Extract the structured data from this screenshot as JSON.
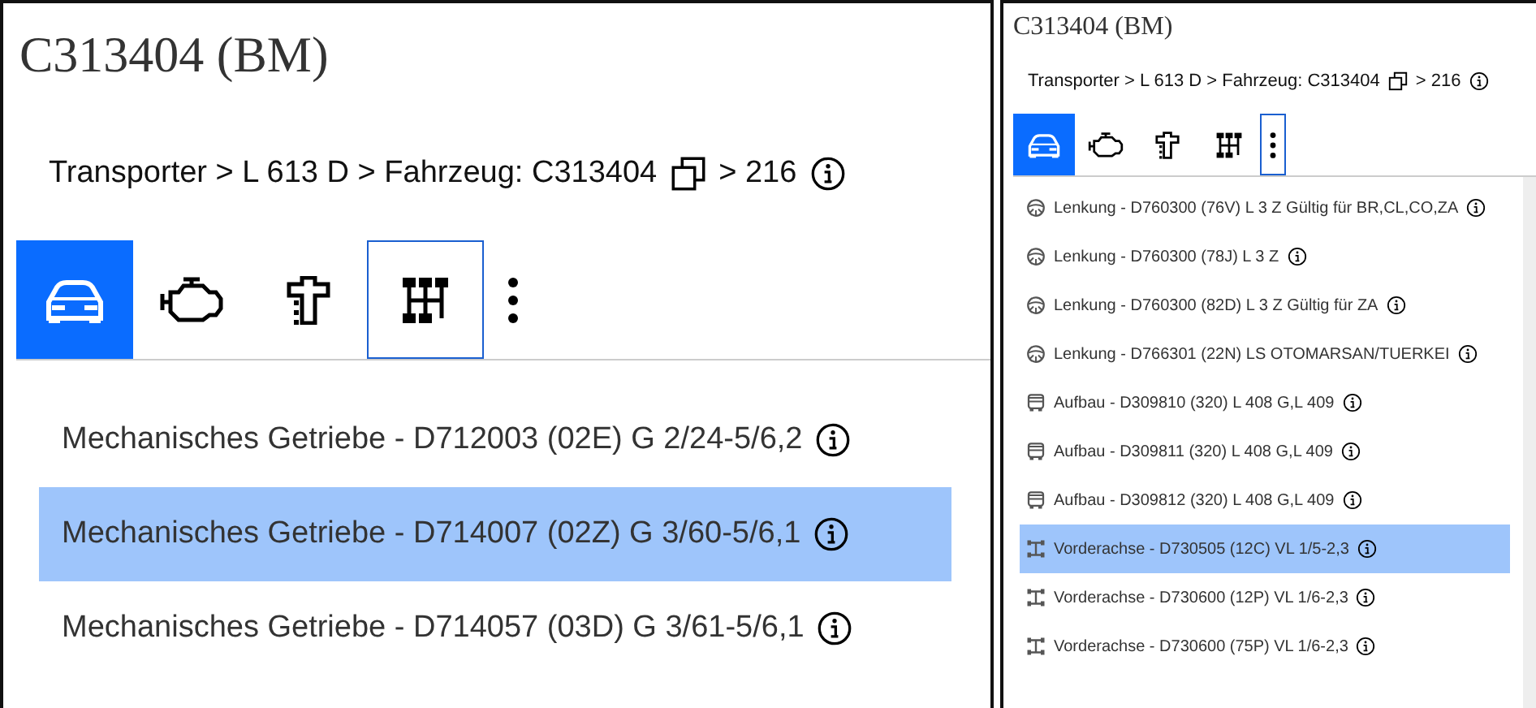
{
  "panels": [
    {
      "title": "C313404 (BM)",
      "breadcrumb": {
        "path": "Transporter > L 613 D > Fahrzeug: C313404",
        "count": "> 216"
      },
      "tabs": [
        {
          "kind": "car",
          "selected": true,
          "focused": false
        },
        {
          "kind": "engine",
          "selected": false,
          "focused": false
        },
        {
          "kind": "steering",
          "selected": false,
          "focused": false
        },
        {
          "kind": "gearbox",
          "selected": false,
          "focused": true
        },
        {
          "kind": "more",
          "selected": false,
          "focused": false
        }
      ],
      "items": [
        {
          "kind": "plain",
          "label": "Mechanisches Getriebe - D712003 (02E) G 2/24-5/6,2",
          "selected": false
        },
        {
          "kind": "plain",
          "label": "Mechanisches Getriebe - D714007 (02Z) G 3/60-5/6,1",
          "selected": true
        },
        {
          "kind": "plain",
          "label": "Mechanisches Getriebe - D714057 (03D) G 3/61-5/6,1",
          "selected": false
        }
      ]
    },
    {
      "title": "C313404 (BM)",
      "breadcrumb": {
        "path": "Transporter > L 613 D > Fahrzeug: C313404",
        "count": "> 216"
      },
      "tabs": [
        {
          "kind": "car",
          "selected": true,
          "focused": false
        },
        {
          "kind": "engine",
          "selected": false,
          "focused": false
        },
        {
          "kind": "steering",
          "selected": false,
          "focused": false
        },
        {
          "kind": "gearbox",
          "selected": false,
          "focused": false
        },
        {
          "kind": "more",
          "selected": false,
          "focused": true
        }
      ],
      "items": [
        {
          "kind": "steering",
          "label": "Lenkung - D760300 (76V) L 3 Z Gültig für BR,CL,CO,ZA",
          "selected": false
        },
        {
          "kind": "steering",
          "label": "Lenkung - D760300 (78J) L 3 Z",
          "selected": false
        },
        {
          "kind": "steering",
          "label": "Lenkung - D760300 (82D) L 3 Z Gültig für ZA",
          "selected": false
        },
        {
          "kind": "steering",
          "label": "Lenkung - D766301 (22N) LS OTOMARSAN/TUERKEI",
          "selected": false
        },
        {
          "kind": "body",
          "label": "Aufbau - D309810 (320) L 408 G,L 409",
          "selected": false
        },
        {
          "kind": "body",
          "label": "Aufbau - D309811 (320) L 408 G,L 409",
          "selected": false
        },
        {
          "kind": "body",
          "label": "Aufbau - D309812 (320) L 408 G,L 409",
          "selected": false
        },
        {
          "kind": "axle",
          "label": "Vorderachse - D730505 (12C) VL 1/5-2,3",
          "selected": true
        },
        {
          "kind": "axle",
          "label": "Vorderachse - D730600 (12P) VL 1/6-2,3",
          "selected": false
        },
        {
          "kind": "axle",
          "label": "Vorderachse - D730600 (75P) VL 1/6-2,3",
          "selected": false
        }
      ]
    }
  ]
}
